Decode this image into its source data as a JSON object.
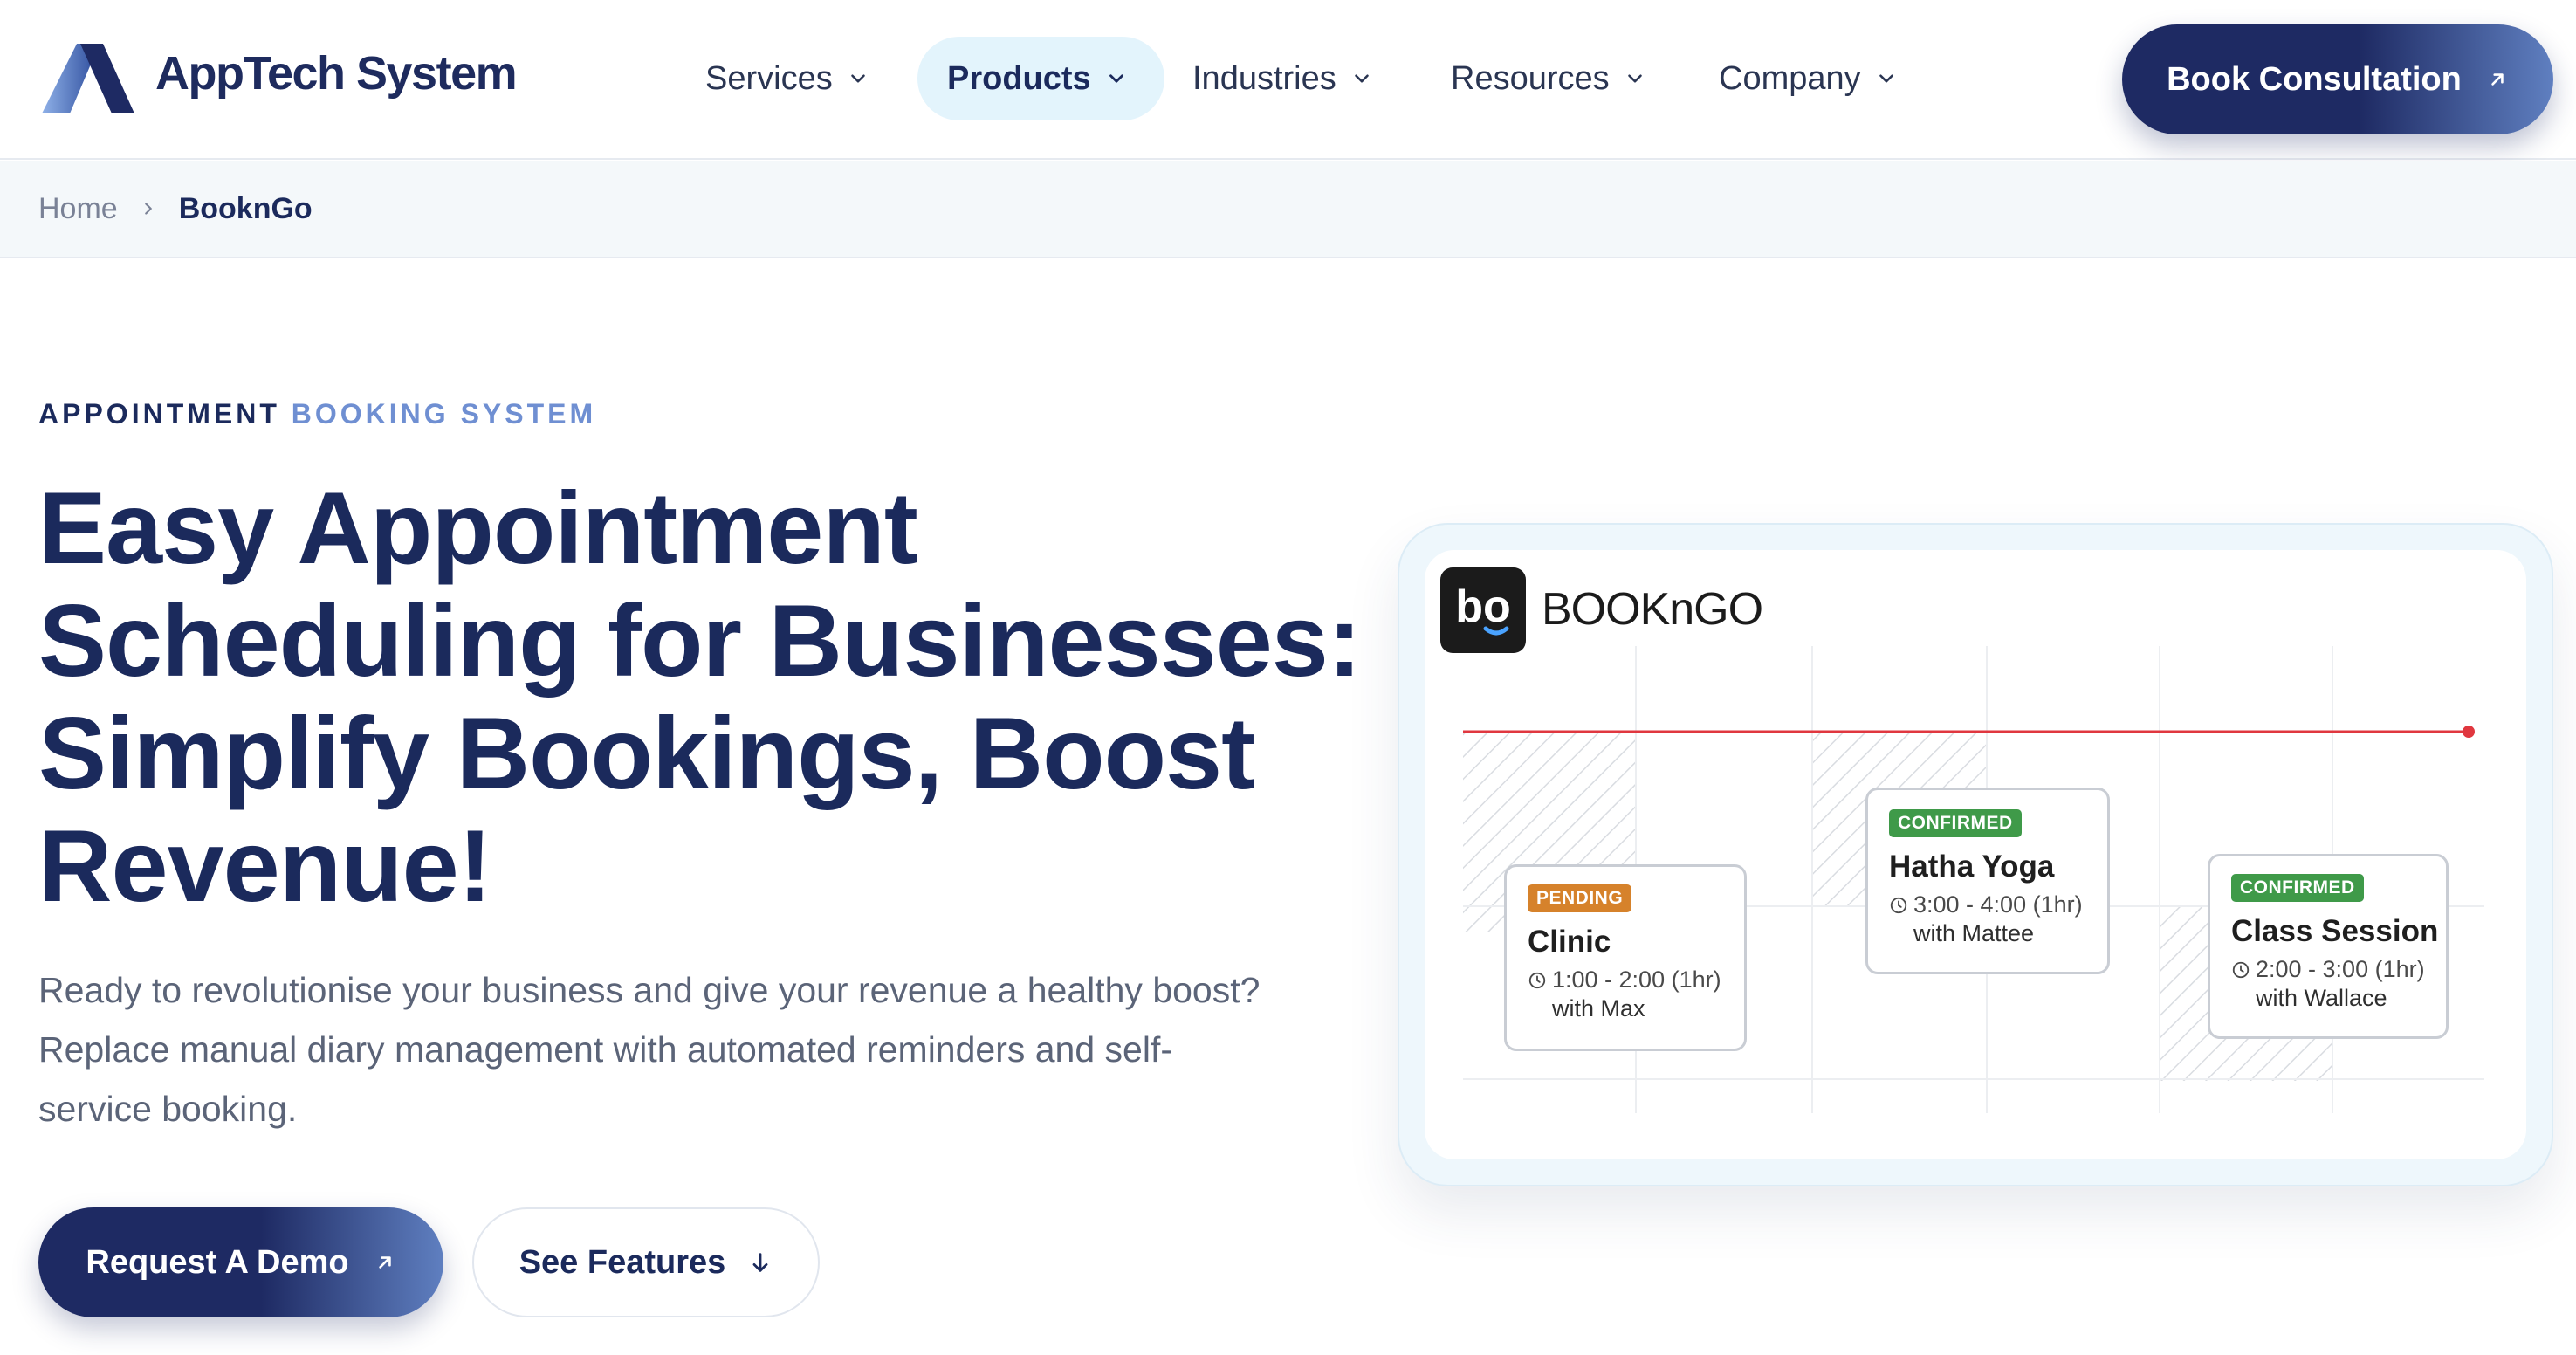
{
  "brand": {
    "name": "AppTech System",
    "logo_icon": "apptech-a-logo-icon",
    "primary_color": "#1e2a63",
    "accent_color": "#6f8fd2"
  },
  "nav": {
    "items": [
      {
        "label": "Services",
        "icon": "chevron-down-icon",
        "active": false
      },
      {
        "label": "Products",
        "icon": "chevron-down-icon",
        "active": true
      },
      {
        "label": "Industries",
        "icon": "chevron-down-icon",
        "active": false
      },
      {
        "label": "Resources",
        "icon": "chevron-down-icon",
        "active": false
      },
      {
        "label": "Company",
        "icon": "chevron-down-icon",
        "active": false
      }
    ],
    "cta_label": "Book Consultation",
    "cta_icon": "arrow-up-right-icon"
  },
  "breadcrumb": {
    "home": "Home",
    "separator_icon": "chevron-right-icon",
    "current": "BooknGo"
  },
  "hero": {
    "eyebrow_part1": "APPOINTMENT",
    "eyebrow_part2": "BOOKING SYSTEM",
    "headline": "Easy Appointment Scheduling for Businesses: Simplify Bookings, Boost Revenue!",
    "lede": "Ready to revolutionise your business and give your revenue a healthy boost? Replace manual diary management with automated reminders and self-service booking.",
    "primary_button": "Request A Demo",
    "primary_icon": "arrow-up-right-icon",
    "secondary_button": "See Features",
    "secondary_icon": "arrow-down-icon"
  },
  "mockup": {
    "app_name": "BOOKnGO",
    "app_logo_text": "bo",
    "current_time_color": "#e0373f",
    "events": [
      {
        "status": "PENDING",
        "title": "Clinic",
        "time": "1:00 - 2:00 (1hr)",
        "with": "with Max",
        "status_color": "#d6822b"
      },
      {
        "status": "CONFIRMED",
        "title": "Hatha Yoga",
        "time": "3:00 - 4:00 (1hr)",
        "with": "with Mattee",
        "status_color": "#3f9a49"
      },
      {
        "status": "CONFIRMED",
        "title": "Class Session",
        "time": "2:00 - 3:00 (1hr)",
        "with": "with Wallace",
        "status_color": "#3f9a49"
      }
    ]
  }
}
